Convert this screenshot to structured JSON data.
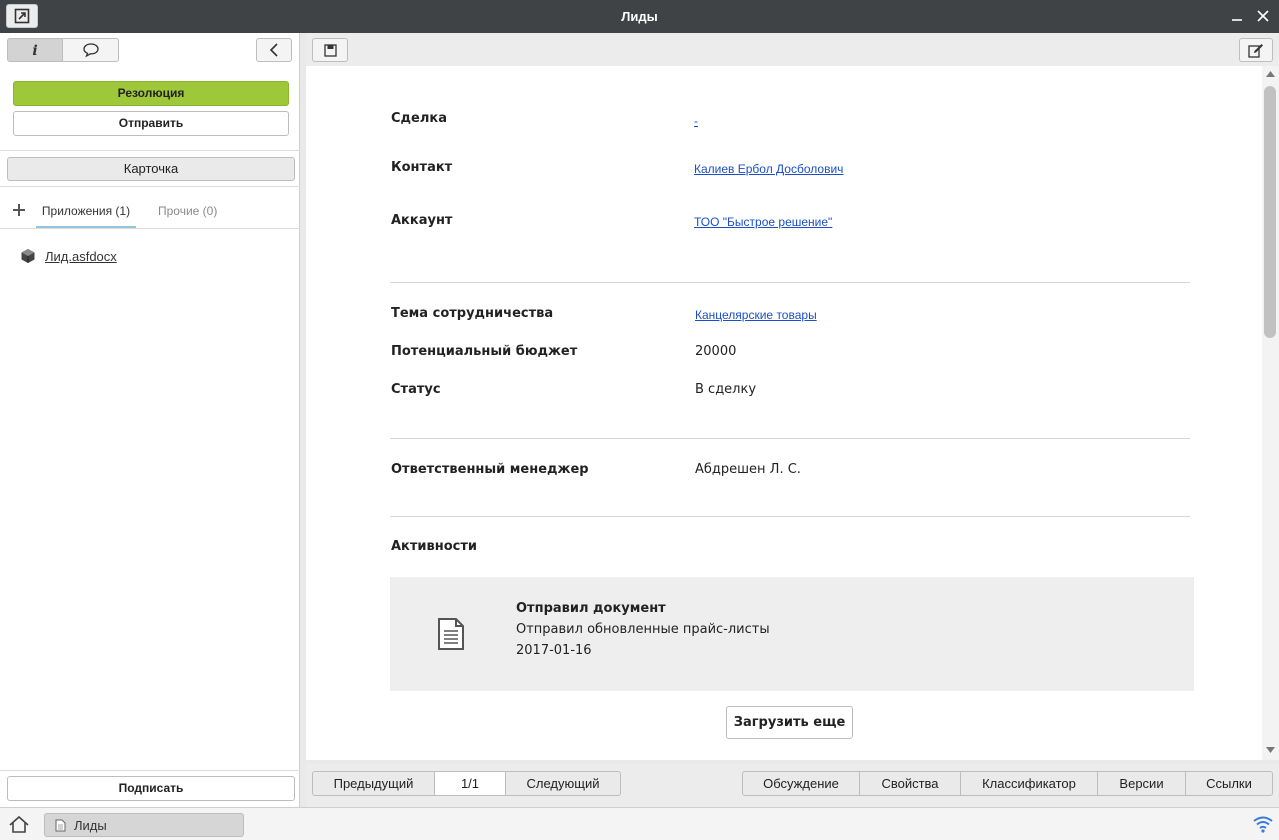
{
  "window": {
    "title": "Лиды"
  },
  "sidebar": {
    "resolution_label": "Резолюция",
    "send_label": "Отправить",
    "card_label": "Карточка",
    "tabs": {
      "attachments": "Приложения (1)",
      "other": "Прочие (0)"
    },
    "file_name": "Лид.asfdocx",
    "sign_label": "Подписать"
  },
  "form": {
    "deal": {
      "label": "Сделка",
      "value": "-"
    },
    "contact": {
      "label": "Контакт",
      "value": "Калиев Ербол Досболович"
    },
    "account": {
      "label": "Аккаунт",
      "value": "ТОО \"Быстрое решение\""
    },
    "topic": {
      "label": "Тема сотрудничества",
      "value": "Канцелярские товары"
    },
    "budget": {
      "label": "Потенциальный бюджет",
      "value": "20000"
    },
    "status": {
      "label": "Статус",
      "value": "В сделку"
    },
    "manager": {
      "label": "Ответственный менеджер",
      "value": "Абдрешен Л. С."
    },
    "activities_label": "Активности"
  },
  "activity": {
    "title": "Отправил документ",
    "description": "Отправил обновленные прайс-листы",
    "date": "2017-01-16"
  },
  "load_more_label": "Загрузить еще",
  "bottom_nav": {
    "prev": "Предыдущий",
    "page": "1/1",
    "next": "Следующий",
    "discussion": "Обсуждение",
    "properties": "Свойства",
    "classifier": "Классификатор",
    "versions": "Версии",
    "links": "Ссылки"
  },
  "taskbar": {
    "item_label": "Лиды"
  },
  "colors": {
    "accent_green": "#9ec83a",
    "link_blue": "#1a4fc8",
    "titlebar": "#3f4345"
  }
}
